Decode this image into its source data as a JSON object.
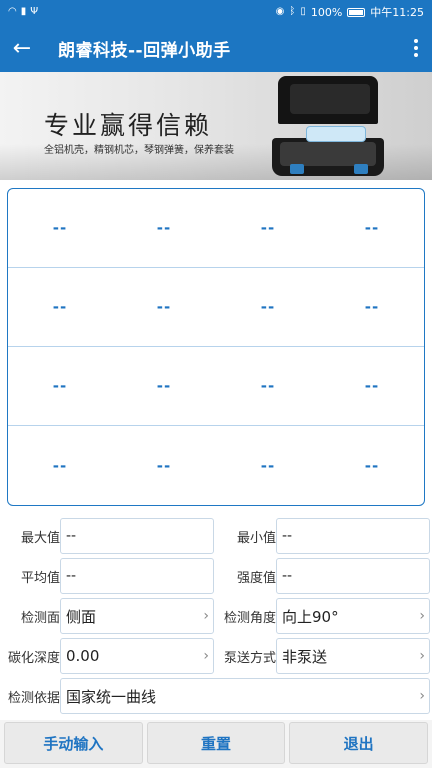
{
  "status_bar": {
    "left_icons": [
      "wifi-icon",
      "signal-icon",
      "usb-icon"
    ],
    "right_icons": [
      "eye-icon",
      "bluetooth-icon",
      "vibrate-icon"
    ],
    "battery": "100%",
    "time": "中午11:25"
  },
  "app_bar": {
    "title": "朗睿科技--回弹小助手"
  },
  "banner": {
    "headline": "专业赢得信赖",
    "subtitle": "全铝机壳，精钢机芯，琴钢弹簧，保养套装",
    "page_count": 5,
    "active_page": 1
  },
  "grid": {
    "rows": [
      [
        "--",
        "--",
        "--",
        "--"
      ],
      [
        "--",
        "--",
        "--",
        "--"
      ],
      [
        "--",
        "--",
        "--",
        "--"
      ],
      [
        "--",
        "--",
        "--",
        "--"
      ]
    ]
  },
  "form": {
    "max_label": "最大值",
    "max_value": "--",
    "min_label": "最小值",
    "min_value": "--",
    "avg_label": "平均值",
    "avg_value": "--",
    "strength_label": "强度值",
    "strength_value": "--",
    "surface_label": "检测面",
    "surface_value": "侧面",
    "angle_label": "检测角度",
    "angle_value": "向上90°",
    "carbon_label": "碳化深度",
    "carbon_value": "0.00",
    "pump_label": "泵送方式",
    "pump_value": "非泵送",
    "basis_label": "检测依据",
    "basis_value": "国家统一曲线"
  },
  "buttons": {
    "manual": "手动输入",
    "reset": "重置",
    "exit": "退出"
  },
  "colors": {
    "primary": "#1c76c2",
    "text_blue": "#1f74c2"
  }
}
